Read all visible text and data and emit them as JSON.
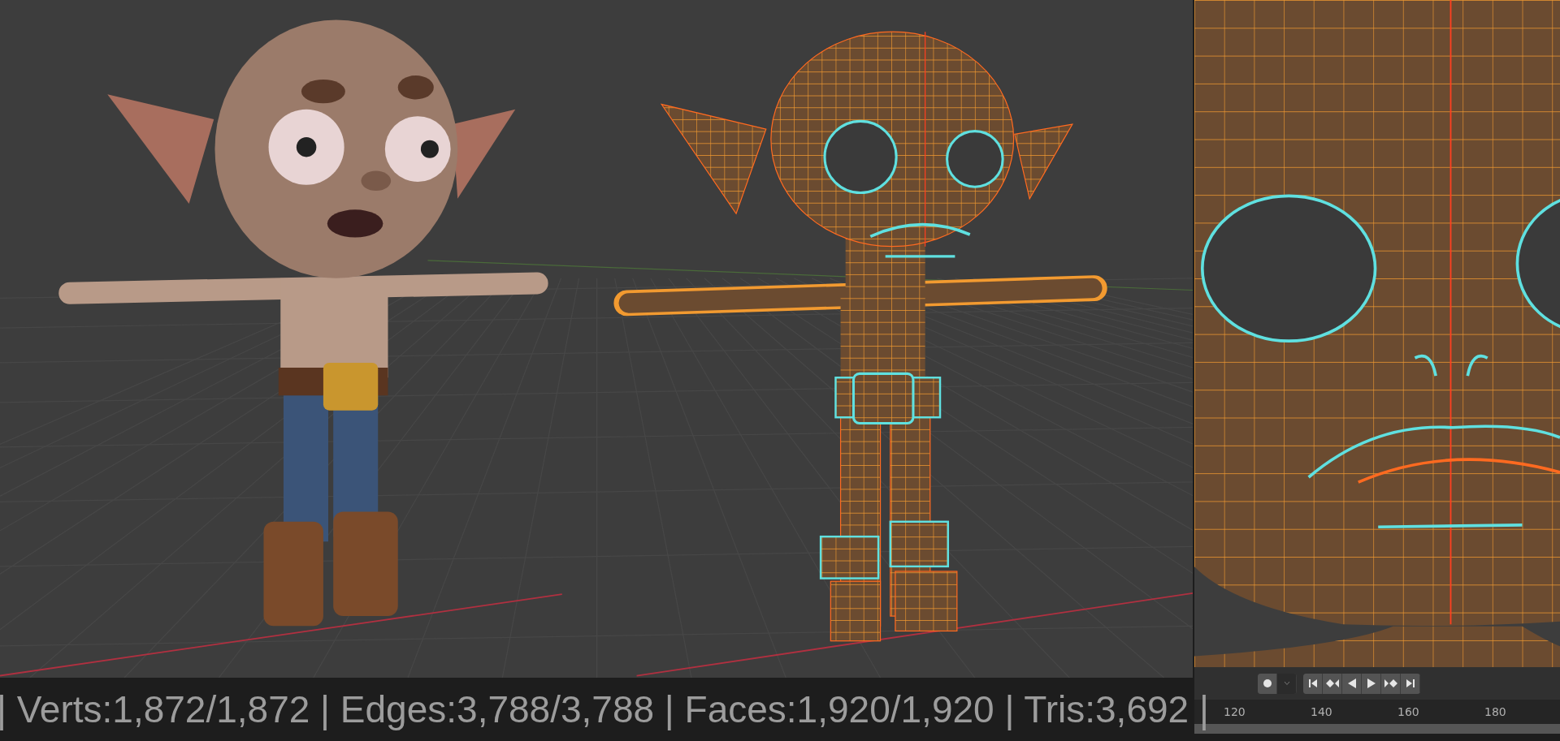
{
  "status_bar": {
    "stats": "| Verts:1,872/1,872 | Edges:3,788/3,788 | Faces:1,920/1,920 | Tris:3,692 |"
  },
  "timeline": {
    "record_buttons": [
      {
        "kind": "record"
      },
      {
        "kind": "dropdown"
      }
    ],
    "transport_buttons": [
      {
        "kind": "jump-start"
      },
      {
        "kind": "prev-key"
      },
      {
        "kind": "play-reverse"
      },
      {
        "kind": "play"
      },
      {
        "kind": "next-key"
      },
      {
        "kind": "jump-end"
      }
    ],
    "frame_labels": [
      "120",
      "140",
      "160",
      "180"
    ]
  }
}
